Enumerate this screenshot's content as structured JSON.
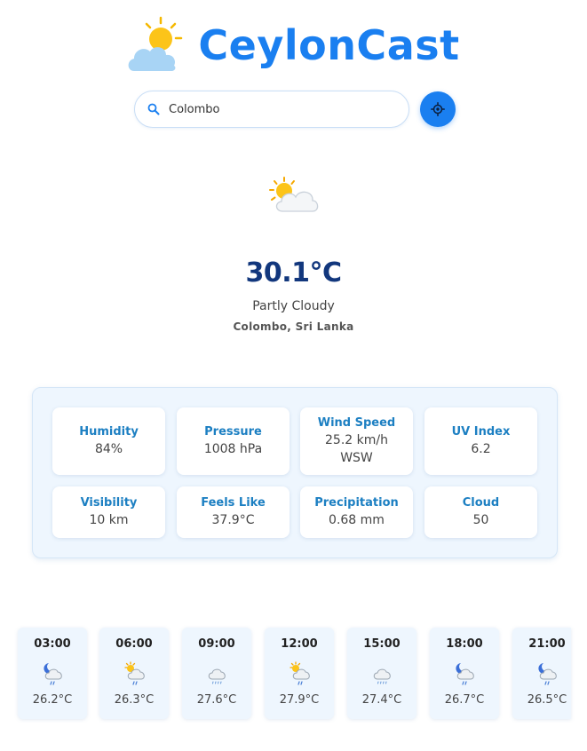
{
  "app": {
    "title": "CeylonCast",
    "brand_color": "#1a7ff0",
    "logo_icon": "sun-behind-cloud-icon"
  },
  "search": {
    "value": "Colombo",
    "search_icon": "search-icon",
    "locate_icon": "crosshair-location-icon"
  },
  "current": {
    "icon": "partly-cloudy-icon",
    "temperature": "30.1°C",
    "condition": "Partly Cloudy",
    "location": "Colombo, Sri Lanka"
  },
  "stats": [
    {
      "label": "Humidity",
      "value": "84%"
    },
    {
      "label": "Pressure",
      "value": "1008 hPa"
    },
    {
      "label": "Wind Speed",
      "value": "25.2 km/h WSW"
    },
    {
      "label": "UV Index",
      "value": "6.2"
    },
    {
      "label": "Visibility",
      "value": "10 km"
    },
    {
      "label": "Feels Like",
      "value": "37.9°C"
    },
    {
      "label": "Precipitation",
      "value": "0.68 mm"
    },
    {
      "label": "Cloud",
      "value": "50"
    }
  ],
  "hourly": [
    {
      "time": "03:00",
      "icon": "night-rain-icon",
      "temp": "26.2°C"
    },
    {
      "time": "06:00",
      "icon": "sun-rain-icon",
      "temp": "26.3°C"
    },
    {
      "time": "09:00",
      "icon": "cloud-rain-icon",
      "temp": "27.6°C"
    },
    {
      "time": "12:00",
      "icon": "sun-rain-icon",
      "temp": "27.9°C"
    },
    {
      "time": "15:00",
      "icon": "cloud-rain-icon",
      "temp": "27.4°C"
    },
    {
      "time": "18:00",
      "icon": "night-rain-icon",
      "temp": "26.7°C"
    },
    {
      "time": "21:00",
      "icon": "night-rain-icon",
      "temp": "26.5°C"
    }
  ]
}
